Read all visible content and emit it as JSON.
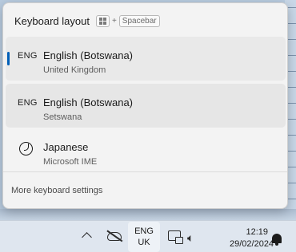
{
  "flyout": {
    "title": "Keyboard layout",
    "shortcut_plus": "+",
    "shortcut_key": "Spacebar",
    "more_settings": "More keyboard settings"
  },
  "languages": [
    {
      "code": "ENG",
      "name": "English (Botswana)",
      "sub": "United Kingdom",
      "selected": true
    },
    {
      "code": "ENG",
      "name": "English (Botswana)",
      "sub": "Setswana",
      "selected": false
    },
    {
      "code": "",
      "name": "Japanese",
      "sub": "Microsoft IME",
      "selected": false
    }
  ],
  "taskbar": {
    "lang_line1": "ENG",
    "lang_line2": "UK",
    "volume_glyph": "🔈︎",
    "time": "12:19",
    "date": "29/02/2024",
    "icons": [
      "chevron-up-icon",
      "cloud-off-icon",
      "network-icon",
      "volume-icon",
      "notification-bell-icon"
    ]
  },
  "colors": {
    "accent": "#005fb8",
    "flyout_bg": "#f3f3f3",
    "taskbar_bg": "#dfe6ef"
  }
}
